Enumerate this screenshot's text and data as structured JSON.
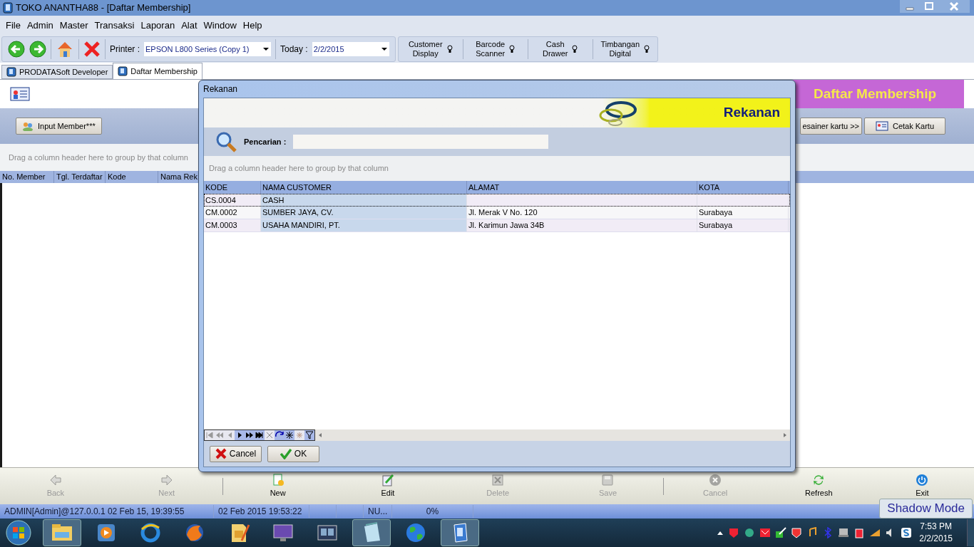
{
  "window": {
    "title": "TOKO ANANTHA88 - [Daftar Membership]"
  },
  "menu": [
    "File",
    "Admin",
    "Master",
    "Transaksi",
    "Laporan",
    "Alat",
    "Window",
    "Help"
  ],
  "toolbar": {
    "printer_label": "Printer :",
    "printer": "EPSON L800 Series (Copy 1)",
    "today_label": "Today :",
    "today": "2/2/2015",
    "devices": [
      {
        "lines": [
          "Customer",
          "Display"
        ]
      },
      {
        "lines": [
          "Barcode",
          "Scanner"
        ]
      },
      {
        "lines": [
          "Cash",
          "Drawer"
        ]
      },
      {
        "lines": [
          "Timbangan",
          "Digital"
        ]
      }
    ]
  },
  "tabs": [
    {
      "label": "PRODATASoft Developer",
      "selected": false
    },
    {
      "label": "Daftar Membership",
      "selected": true
    }
  ],
  "form": {
    "banner": "Daftar Membership",
    "input_button": "Input Member***",
    "designer_button": "esainer kartu >>",
    "print_button": "Cetak Kartu",
    "group_hint": "Drag a column header here to group by that column",
    "columns": [
      "No. Member",
      "Tgl. Terdaftar",
      "Kode",
      "Nama Rek"
    ]
  },
  "nav_buttons": [
    {
      "kind": "back",
      "label": "Back",
      "disabled": true
    },
    {
      "kind": "next",
      "label": "Next",
      "disabled": true
    },
    {
      "kind": "new",
      "label": "New",
      "disabled": false
    },
    {
      "kind": "edit",
      "label": "Edit",
      "disabled": false
    },
    {
      "kind": "delete",
      "label": "Delete",
      "disabled": true
    },
    {
      "kind": "save",
      "label": "Save",
      "disabled": true
    },
    {
      "kind": "cancel",
      "label": "Cancel",
      "disabled": true
    },
    {
      "kind": "refresh",
      "label": "Refresh",
      "disabled": false
    },
    {
      "kind": "exit",
      "label": "Exit",
      "disabled": false
    }
  ],
  "status_bar": {
    "session": "ADMIN[Admin]@127.0.0.1 02 Feb 15, 19:39:55",
    "now": "02 Feb 2015 19:53:22",
    "numlock": "NU...",
    "progress": "0%"
  },
  "shadow_mode": "Shadow Mode",
  "dialog": {
    "title": "Rekanan",
    "header": "Rekanan",
    "search_label": "Pencarian :",
    "group_hint": "Drag a column header here to group by that column",
    "columns": [
      "KODE",
      "NAMA CUSTOMER",
      "ALAMAT",
      "KOTA"
    ],
    "rows": [
      {
        "kode": "CS.0004",
        "nama": "CASH",
        "selected": true
      },
      {
        "kode": "CM.0002",
        "nama": "SUMBER JAYA, CV.",
        "alamat": "Jl. Merak V No. 120",
        "kota": "Surabaya",
        "selected": false
      },
      {
        "kode": "CM.0003",
        "nama": "USAHA MANDIRI, PT.",
        "alamat": "Jl. Karimun Jawa 34B",
        "kota": "Surabaya",
        "selected": false
      }
    ],
    "buttons": [
      {
        "kind": "cancel",
        "label": "Cancel"
      },
      {
        "kind": "ok",
        "label": "OK"
      }
    ]
  },
  "clock": {
    "time": "7:53 PM",
    "date": "2/2/2015"
  }
}
